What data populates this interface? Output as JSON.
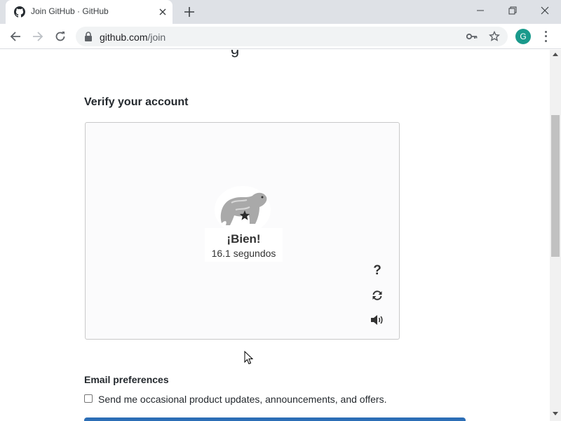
{
  "browser": {
    "tab": {
      "title": "Join GitHub · GitHub"
    },
    "url": {
      "host": "github.com",
      "path": "/join"
    },
    "profile_initial": "G"
  },
  "page": {
    "cut_heading": "g",
    "verify_title": "Verify your account",
    "captcha": {
      "result_title": "¡Bien!",
      "result_time": "16.1 segundos",
      "help_label": "?"
    },
    "email_section_title": "Email preferences",
    "email_checkbox_label": "Send me occasional product updates, announcements, and offers."
  }
}
